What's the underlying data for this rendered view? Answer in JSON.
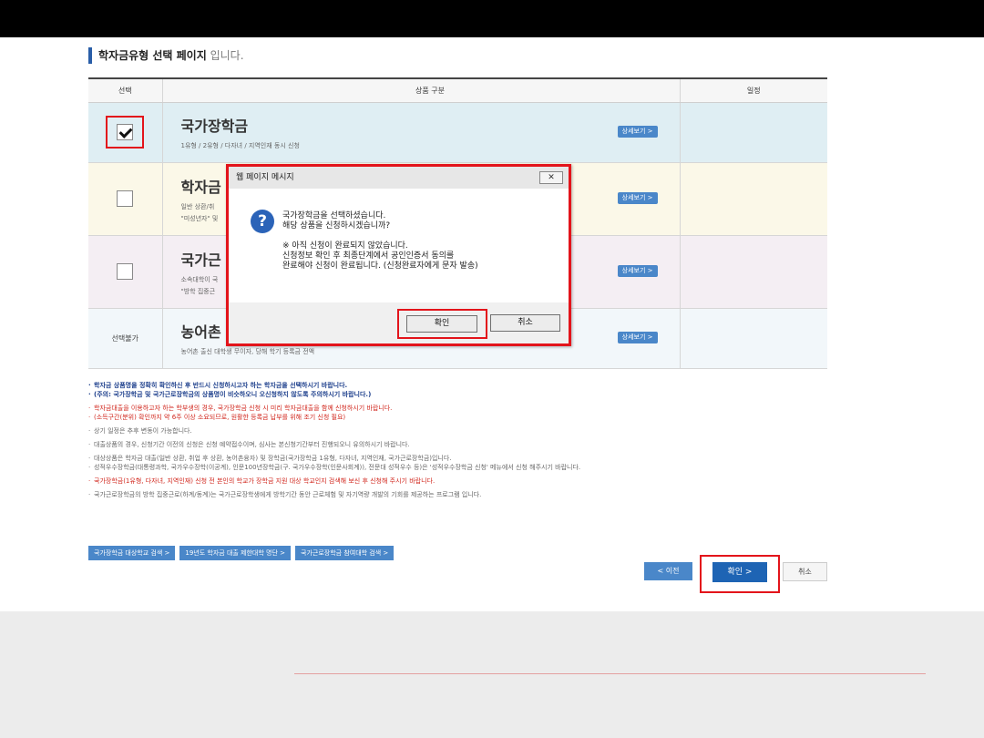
{
  "header": {
    "title_strong": "학자금유형 선택 페이지",
    "title_suffix": "입니다."
  },
  "table": {
    "columns": [
      "선택",
      "상품 구분",
      "일정"
    ],
    "rows": [
      {
        "name": "국가장학금",
        "desc": "1유형 / 2유형 / 다자녀 / 지역인재 동시 신청",
        "desc2": "",
        "selection": "checked",
        "detail": "상세보기 >"
      },
      {
        "name": "학자금",
        "desc": "일반 상환/취",
        "desc2": "\"미성년자\" 및",
        "selection": "unchecked",
        "detail": "상세보기 >"
      },
      {
        "name": "국가근",
        "desc": "소속대학이 국",
        "desc2": "\"방학 집중근",
        "selection": "unchecked",
        "detail": "상세보기 >"
      },
      {
        "name": "농어촌",
        "desc": "농어촌 출신 대학생 무이자, 당해 학기 등록금 전액",
        "desc2": "",
        "selection": "unavailable",
        "selection_label": "선택불가",
        "detail": "상세보기 >"
      }
    ]
  },
  "notes": [
    {
      "style": "blue",
      "text": "학자금 상품명을 정확히 확인하신 후 반드시 신청하시고자 하는 학자금을 선택하시기 바랍니다."
    },
    {
      "style": "blue",
      "text": "(주의: 국가장학금 및 국가근로장학금의 상품명이 비슷하오니 오신청하지 않도록 주의하시기 바랍니다.)"
    },
    {
      "style": "red",
      "text": "학자금대출을 이용하고자 하는 학부생의 경우, 국가장학금 신청 시 미리 학자금대출을 함께 신청하시기 바랍니다."
    },
    {
      "style": "red",
      "text": "(소득구간(분위) 확인까지 약 6주 이상 소요되므로, 원활한 등록금 납부를 위해 조기 신청 필요)"
    },
    {
      "style": "plain",
      "text": "상기 일정은 추후 변동이 가능합니다."
    },
    {
      "style": "plain",
      "text": "대출상품의 경우, 신청기간 이전의 신청은 신청 예약접수이며, 심사는 본신청기간부터 진행되오니 유의하시기 바랍니다."
    },
    {
      "style": "plain",
      "text": "대상상품은 학자금 대출(일반 상환, 취업 후 상환, 농어촌융자) 및 장학금(국가장학금 1유형, 다자녀, 지역인재, 국가근로장학금)입니다."
    },
    {
      "style": "plain",
      "text": "성적우수장학금(대통령과학, 국가우수장학(이공계), 인문100년장학금(구. 국가우수장학(인문사회계)), 전문대 성적우수 등)은 '성적우수장학금 신청' 메뉴에서 신청 해주시기 바랍니다."
    },
    {
      "style": "red",
      "text": "국가장학금(1유형, 다자녀, 지역인재) 신청 전 본인의 학교가 장학금 지원 대상 학교인지 검색해 보신 후 신청해 주시기 바랍니다."
    },
    {
      "style": "plain",
      "text": "국가근로장학금의 방학 집중근로(하계/동계)는 국가근로장학생에게 방학기간 동안 근로체험 및 자기역량 개발의 기회를 제공하는 프로그램 입니다."
    }
  ],
  "links": [
    "국가장학금 대상학교 검색 >",
    "19년도 학자금 대출 제한대학 명단 >",
    "국가근로장학금 참여대학 검색 >"
  ],
  "actions": {
    "prev": "< 이전",
    "confirm": "확인 >",
    "cancel": "취소"
  },
  "dialog": {
    "title": "웹 페이지 메시지",
    "close": "✕",
    "line1": "국가장학금을 선택하셨습니다.",
    "line2": "해당 상품을 신청하시겠습니까?",
    "line3": "※ 아직 신청이 완료되지 않았습니다.",
    "line4": "신청정보 확인 후 최종단계에서 공인인증서 동의를",
    "line5": "완료해야 신청이 완료됩니다. (신청완료자에게 문자 발송)",
    "ok": "확인",
    "cancel": "취소"
  },
  "colors": {
    "accent": "#2a5ea8",
    "button_blue": "#4a87c9",
    "highlight_red": "#e3141b"
  }
}
